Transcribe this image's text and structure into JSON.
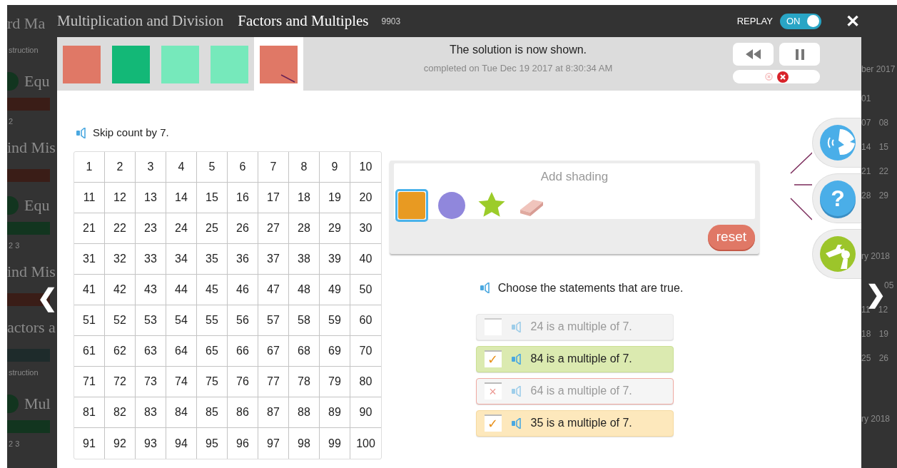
{
  "background": {
    "left": [
      {
        "kind": "heading",
        "text": "rd Ma"
      },
      {
        "kind": "small",
        "text": "struction"
      },
      {
        "kind": "lesson",
        "text": "Equ"
      },
      {
        "kind": "bar",
        "color": "#3a1d17"
      },
      {
        "kind": "small",
        "text": "2"
      },
      {
        "kind": "heading",
        "text": "ind Mis"
      },
      {
        "kind": "bar",
        "color": "#3a1d17"
      },
      {
        "kind": "lesson",
        "text": "Equ"
      },
      {
        "kind": "bar",
        "color": "#12351f"
      },
      {
        "kind": "small",
        "text": "2   3"
      },
      {
        "kind": "heading",
        "text": "ind Mis"
      },
      {
        "kind": "bar",
        "color": "#3a1d17"
      },
      {
        "kind": "heading",
        "text": "actors a"
      },
      {
        "kind": "bar",
        "color": "#1e2b2b"
      },
      {
        "kind": "small",
        "text": "struction"
      },
      {
        "kind": "lesson",
        "text": "Mul"
      },
      {
        "kind": "bar",
        "color": "#12351f"
      },
      {
        "kind": "small",
        "text": "2   3"
      }
    ],
    "right": [
      {
        "kind": "month",
        "text": "ber 2017"
      },
      {
        "kind": "days",
        "text": "01"
      },
      {
        "kind": "days",
        "text": "07 08"
      },
      {
        "kind": "days",
        "text": "14 15"
      },
      {
        "kind": "days",
        "text": "21 22"
      },
      {
        "kind": "days",
        "text": "28 29"
      },
      {
        "kind": "month",
        "text": "ry 2018"
      },
      {
        "kind": "days_partial",
        "text": "05"
      },
      {
        "kind": "days",
        "text": "11 12"
      },
      {
        "kind": "days",
        "text": "18 19"
      },
      {
        "kind": "days",
        "text": "25 26"
      },
      {
        "kind": "month",
        "text": "ry 2018"
      }
    ]
  },
  "header": {
    "unit": "Multiplication and Division",
    "lesson": "Factors and Multiples",
    "code": "9903",
    "replay_label": "REPLAY",
    "replay": {
      "label": "ON",
      "on": true
    },
    "close": "✕"
  },
  "attempts": [
    {
      "color": "#e07866",
      "selected": false
    },
    {
      "color": "#13b877",
      "selected": false
    },
    {
      "color": "#76e9bb",
      "selected": false
    },
    {
      "color": "#76e9bb",
      "selected": false
    },
    {
      "color": "#e07866",
      "selected": true
    }
  ],
  "status": {
    "title": "The solution is now shown.",
    "subtitle": "completed on Tue Dec 19 2017 at 8:30:34 AM"
  },
  "nav": {
    "prev": "❮",
    "next": "❯"
  },
  "question": {
    "prompt": "Skip count by 7.",
    "grid_rows": [
      [
        "1",
        "2",
        "3",
        "4",
        "5",
        "6",
        "7",
        "8",
        "9",
        "10"
      ],
      [
        "11",
        "12",
        "13",
        "14",
        "15",
        "16",
        "17",
        "18",
        "19",
        "20"
      ],
      [
        "21",
        "22",
        "23",
        "24",
        "25",
        "26",
        "27",
        "28",
        "29",
        "30"
      ],
      [
        "31",
        "32",
        "33",
        "34",
        "35",
        "36",
        "37",
        "38",
        "39",
        "40"
      ],
      [
        "41",
        "42",
        "43",
        "44",
        "45",
        "46",
        "47",
        "48",
        "49",
        "50"
      ],
      [
        "51",
        "52",
        "53",
        "54",
        "55",
        "56",
        "57",
        "58",
        "59",
        "60"
      ],
      [
        "61",
        "62",
        "63",
        "64",
        "65",
        "66",
        "67",
        "68",
        "69",
        "70"
      ],
      [
        "71",
        "72",
        "73",
        "74",
        "75",
        "76",
        "77",
        "78",
        "79",
        "80"
      ],
      [
        "81",
        "82",
        "83",
        "84",
        "85",
        "86",
        "87",
        "88",
        "89",
        "90"
      ],
      [
        "91",
        "92",
        "93",
        "94",
        "95",
        "96",
        "97",
        "98",
        "99",
        "100"
      ]
    ]
  },
  "shading": {
    "title": "Add shading",
    "tools": [
      {
        "kind": "square",
        "selected": true
      },
      {
        "kind": "circle",
        "selected": false
      },
      {
        "kind": "star",
        "selected": false
      },
      {
        "kind": "eraser",
        "selected": false
      }
    ],
    "reset": "reset"
  },
  "statements": {
    "prompt": "Choose the statements that are true.",
    "items": [
      {
        "text": "24 is a multiple of 7.",
        "kind": "plain",
        "checked": false
      },
      {
        "text": "84 is a multiple of 7.",
        "mark": "✓",
        "kind": "correct",
        "checked": true
      },
      {
        "text": "64 is a multiple of 7.",
        "mark": "×",
        "kind": "incorrect",
        "checked": true
      },
      {
        "text": "35 is a multiple of 7.",
        "mark": "✓",
        "kind": "missed",
        "checked": true
      }
    ]
  },
  "side_buttons": [
    {
      "kind": "speech"
    },
    {
      "kind": "help",
      "label": "?"
    },
    {
      "kind": "tools"
    }
  ]
}
